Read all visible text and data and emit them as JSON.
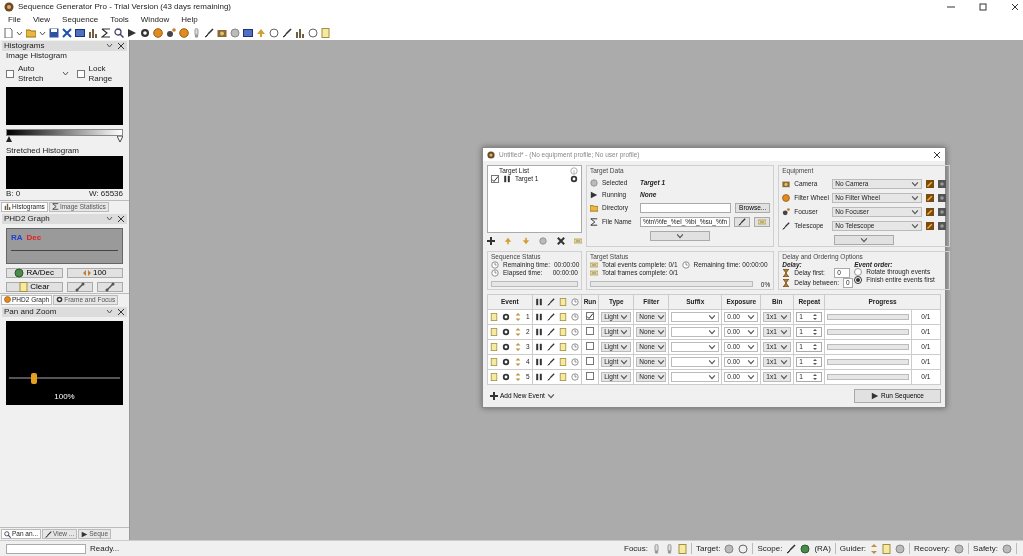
{
  "window": {
    "title": "Sequence Generator Pro - Trial Version (43 days remaining)"
  },
  "menu": [
    "File",
    "View",
    "Sequence",
    "Tools",
    "Window",
    "Help"
  ],
  "histograms_panel": {
    "title": "Histograms",
    "group": "Image Histogram",
    "auto_stretch": {
      "label": "Auto Stretch",
      "checked": false
    },
    "lock_range": {
      "label": "Lock Range",
      "checked": false
    },
    "stretched_label": "Stretched Histogram",
    "black_point": "B: 0",
    "white_point": "W: 65536"
  },
  "dock_tabs_1": [
    {
      "label": "Histograms",
      "selected": true
    },
    {
      "label": "Image Statistics",
      "selected": false
    }
  ],
  "phd2_panel": {
    "title": "PHD2 Graph",
    "legend": [
      {
        "label": "RA",
        "color": "#1f3fd0"
      },
      {
        "label": "Dec",
        "color": "#e02020"
      }
    ],
    "radec_button": "RA/Dec",
    "scale_button": "100",
    "clear_button": "Clear"
  },
  "dock_tabs_2": [
    {
      "label": "PHD2 Graph",
      "selected": true
    },
    {
      "label": "Frame and Focus",
      "selected": false
    }
  ],
  "pan_zoom_panel": {
    "title": "Pan and Zoom",
    "zoom_label": "100%",
    "level": 0.2
  },
  "dock_tabs_3": [
    {
      "label": "Pan an...",
      "selected": true
    },
    {
      "label": "View ...",
      "selected": false
    },
    {
      "label": "Seque",
      "selected": false
    }
  ],
  "status_bar": {
    "message": "Ready...",
    "focus": "Focus:",
    "target": "Target:",
    "scope": "Scope:",
    "scope_axis": "(RA)",
    "guider": "Guider:",
    "recovery": "Recovery:",
    "safety": "Safety:"
  },
  "dialog": {
    "title": "Untitled* - (No equipment profile; No user profile)",
    "target_list": {
      "title": "Target List",
      "targets": [
        {
          "name": "Target 1",
          "checked": true
        }
      ]
    },
    "target_data": {
      "title": "Target Data",
      "selected_label": "Selected",
      "selected_value": "Target 1",
      "running_label": "Running",
      "running_value": "None",
      "directory_label": "Directory",
      "browse": "Browse...",
      "file_name_label": "File Name",
      "file_name_value": "%tn\\%fe_%el_%bi_%su_%fn"
    },
    "equipment": {
      "title": "Equipment",
      "items": [
        {
          "kind": "camera",
          "label": "Camera",
          "value": "No Camera"
        },
        {
          "kind": "filter",
          "label": "Filter Wheel",
          "value": "No Filter Wheel"
        },
        {
          "kind": "focuser",
          "label": "Focuser",
          "value": "No Focuser"
        },
        {
          "kind": "telescope",
          "label": "Telescope",
          "value": "No Telescope"
        }
      ]
    },
    "sequence_status": {
      "title": "Sequence Status",
      "remaining_label": "Remaining time:",
      "remaining_value": "00:00:00",
      "elapsed_label": "Elapsed time:",
      "elapsed_value": "00:00:00",
      "level": 0
    },
    "target_status": {
      "title": "Target Status",
      "events_complete": "Total events complete: 0/1",
      "remaining": "Remaining time: 00:00:00",
      "frames_complete": "Total frames complete: 0/1",
      "level": 0,
      "percent": "0%"
    },
    "delay_options": {
      "title": "Delay and Ordering Options",
      "delay_heading": "Delay:",
      "delay_first_label": "Delay first:",
      "delay_first_value": "0",
      "delay_between_label": "Delay between:",
      "delay_between_value": "0",
      "order_heading": "Event order:",
      "orders": [
        {
          "label": "Rotate through events",
          "selected": false
        },
        {
          "label": "Finish entire events first",
          "selected": true
        }
      ]
    },
    "columns": [
      "Event",
      "Run",
      "Type",
      "Filter",
      "Suffix",
      "Exposure",
      "Bin",
      "Repeat",
      "Progress"
    ],
    "events": [
      {
        "number": "1",
        "run": true,
        "type": "Light",
        "filter": "None",
        "exposure": "0.00",
        "bin": "1x1",
        "repeat": "1",
        "level": 0,
        "progress": "0/1"
      },
      {
        "number": "2",
        "run": false,
        "type": "Light",
        "filter": "None",
        "exposure": "0.00",
        "bin": "1x1",
        "repeat": "1",
        "level": 0,
        "progress": "0/1"
      },
      {
        "number": "3",
        "run": false,
        "type": "Light",
        "filter": "None",
        "exposure": "0.00",
        "bin": "1x1",
        "repeat": "1",
        "level": 0,
        "progress": "0/1"
      },
      {
        "number": "4",
        "run": false,
        "type": "Light",
        "filter": "None",
        "exposure": "0.00",
        "bin": "1x1",
        "repeat": "1",
        "level": 0,
        "progress": "0/1"
      },
      {
        "number": "5",
        "run": false,
        "type": "Light",
        "filter": "None",
        "exposure": "0.00",
        "bin": "1x1",
        "repeat": "1",
        "level": 0,
        "progress": "0/1"
      }
    ],
    "add_event": "Add New Event",
    "run_sequence": "Run Sequence"
  }
}
